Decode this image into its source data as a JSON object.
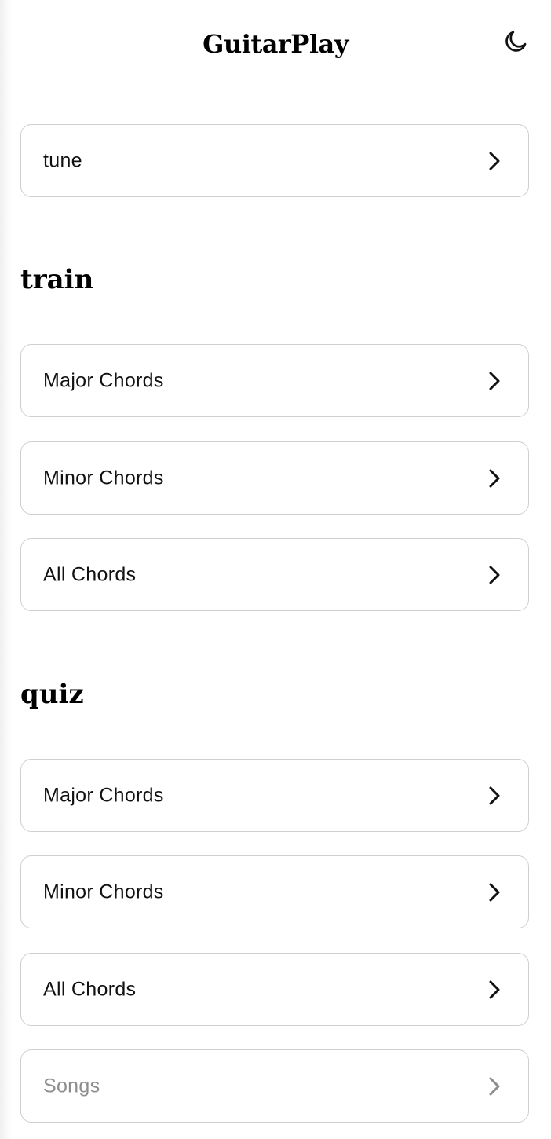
{
  "header": {
    "title": "GuitarPlay",
    "theme_toggle_icon": "moon-icon"
  },
  "tune_section": {
    "items": [
      {
        "label": "tune",
        "icon": "chevron-right-icon",
        "disabled": false
      }
    ]
  },
  "train_section": {
    "heading": "train",
    "items": [
      {
        "label": "Major Chords",
        "icon": "chevron-right-icon",
        "disabled": false
      },
      {
        "label": "Minor Chords",
        "icon": "chevron-right-icon",
        "disabled": false
      },
      {
        "label": "All Chords",
        "icon": "chevron-right-icon",
        "disabled": false
      }
    ]
  },
  "quiz_section": {
    "heading": "quiz",
    "items": [
      {
        "label": "Major Chords",
        "icon": "chevron-right-icon",
        "disabled": false
      },
      {
        "label": "Minor Chords",
        "icon": "chevron-right-icon",
        "disabled": false
      },
      {
        "label": "All Chords",
        "icon": "chevron-right-icon",
        "disabled": false
      },
      {
        "label": "Songs",
        "icon": "chevron-right-icon",
        "disabled": true
      }
    ]
  },
  "colors": {
    "text": "#111111",
    "border": "#cfcfcf",
    "disabled_text": "#8d8d8d",
    "background": "#ffffff"
  }
}
